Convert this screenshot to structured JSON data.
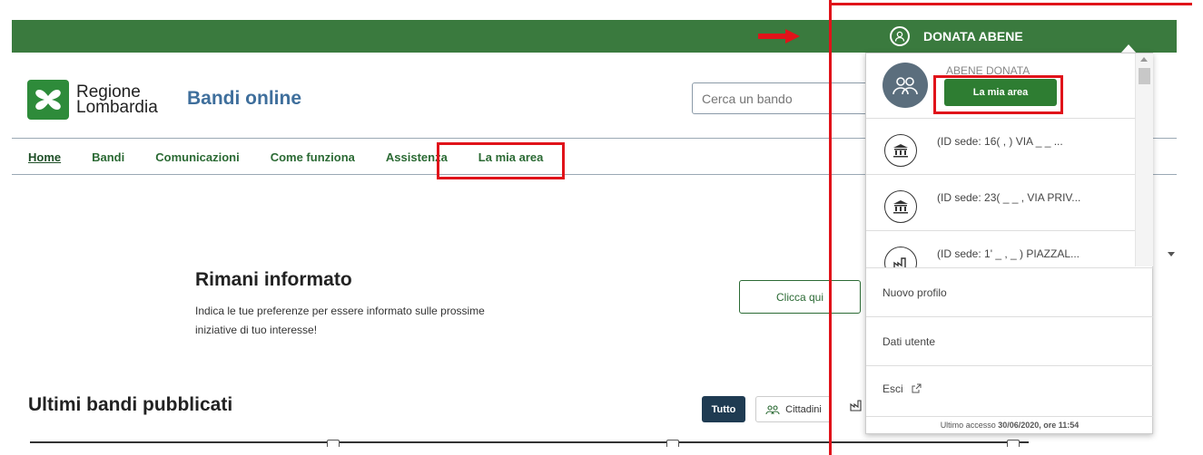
{
  "header": {
    "user_name": "DONATA ABENE",
    "logo_line1": "Regione",
    "logo_line2": "Lombardia",
    "site_title": "Bandi online",
    "search_placeholder": "Cerca un bando"
  },
  "nav": {
    "items": [
      "Home",
      "Bandi",
      "Comunicazioni",
      "Come funziona",
      "Assistenza",
      "La mia area"
    ]
  },
  "info": {
    "title": "Rimani informato",
    "text": "Indica le tue preferenze per essere informato sulle prossime iniziative di tuo interesse!",
    "button": "Clicca qui"
  },
  "latest": {
    "title": "Ultimi bandi pubblicati",
    "filters": [
      "Tutto",
      "Cittadini"
    ]
  },
  "dropdown": {
    "profile_name": "ABENE DONATA",
    "area_button": "La mia area",
    "profiles": [
      {
        "icon": "building-icon",
        "label": "(ID sede: 16( , ) VIA _ _ ..."
      },
      {
        "icon": "building-icon",
        "label": "(ID sede: 23( _ _ , VIA PRIV..."
      },
      {
        "icon": "factory-icon",
        "label": "(ID sede: 1' _ , _ ) PIAZZAL..."
      }
    ],
    "links": [
      "Nuovo profilo",
      "Dati utente",
      "Esci"
    ],
    "last_access_prefix": "Ultimo accesso",
    "last_access_value": "30/06/2020, ore 11:54"
  },
  "colors": {
    "topbar": "#3a7a3e",
    "accent_green": "#2e7d32",
    "annotation_red": "#e0131a",
    "title_blue": "#3f6f9c"
  }
}
